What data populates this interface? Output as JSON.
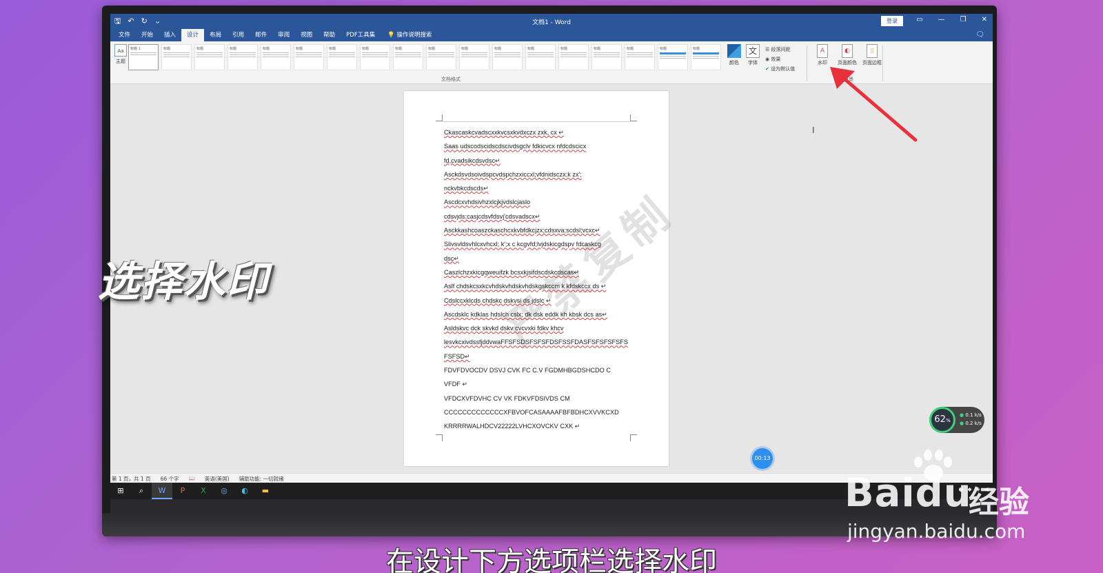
{
  "window": {
    "title": "文档1 - Word",
    "login_label": "登录",
    "controls": [
      "▭",
      "—",
      "❐",
      "✕"
    ]
  },
  "menu": {
    "tabs": [
      "文件",
      "开始",
      "插入",
      "设计",
      "布局",
      "引用",
      "邮件",
      "审阅",
      "视图",
      "帮助",
      "PDF工具集"
    ],
    "active_tab": "设计",
    "tell_me": "操作说明搜索"
  },
  "ribbon": {
    "theme_label": "主题",
    "document_format_label": "文档格式",
    "style_thumbs": [
      "标题 1",
      "标题",
      "标题",
      "标题",
      "标题",
      "标题",
      "标题",
      "标题",
      "标题",
      "标题",
      "标题",
      "标题",
      "标题",
      "标题",
      "标题",
      "标题",
      "标题",
      "标题"
    ],
    "colors_label": "颜色",
    "fonts_label": "字体",
    "paragraph_spacing_label": "段落间距",
    "effects_label": "效果",
    "set_default_label": "设为默认值",
    "watermark_label": "水印",
    "page_color_label": "页面颜色",
    "page_border_label": "页面边框",
    "page_background_label": "页面背景"
  },
  "document": {
    "watermark_text": "严禁复制",
    "lines": [
      "Ckascaskcvadscxxkvcsxkvdxczx zxk, cx ↵",
      "Saas   udscodscidscdscivdsgclv    fdkicvcx    nfdcdscicx",
      "fd,cvadsikcdsvdsc↵",
      "Asckdsvdsoivdspcvdspchzxiccxl;vfdnidsczx;k              zx';",
      "nckvbkcdscds↵",
      "Ascdcxvhdsivhzxlcjkjvdslcjaslo",
      "cdsvjds;casjcdsvfdsvj'cdsvadscx↵",
      "Asckkashcoaszckaschcxkvbfdkcjzx;cdsxva;scdsl;vcxc↵",
      "Slivsvldsvhlcxvhcxl;  k';x   c   kcgvfd;lvjdskicgdspv   fdcaskcg",
      "dsc↵",
      "Caszlchzxkicgqweuifzk bcsxkjsifdscdskcdscas↵",
      "Aslf  chdskcsxkcvhdskvhdskvhdskgskccm k kfdskccx  ds  ↵",
      "Cdslccxklcds    chdskc  dskvsi     ds  jdslc  ↵",
      "Ascdsklc kdklas hdslch cslx; dk dsk eddk kh kbsk dcs as↵",
      "Asldskvc    dck    skvkd    dskv      cvcvxki     fdkv    khcv",
      "lesvkcxivdssfjddvwaFFSFSDSFSFSFDSFSSFDASFSFSFSFSFS",
      "FSFSD↵",
      "FDVFDVOCDV DSVJ CVK FC C.V FGDMHBGDSHCDO C",
      "VFDF ↵",
      "VFDCXVFDVHC     CV     VK     FDKVFDSIVDS           CM",
      "CCCCCCCCCCCCCXFBVOFCASAAAAFBFBDHCXVVKCXD",
      "KRRRRWALHDCV22222LVHCXOVCKV CXK         ↵"
    ]
  },
  "status": {
    "page": "第 1 页，共 1 页",
    "words": "66 个字",
    "language": "英语(美国)",
    "accessibility": "辅助功能: 一切就绪"
  },
  "overlay": {
    "timer": "00:13",
    "cpu_percent": "62",
    "cpu_unit": "%",
    "upload_rate": "0.1",
    "download_rate": "0.2",
    "rate_unit": "k/s",
    "big_caption": "选择水印",
    "subtitle": "在设计下方选项栏选择水印",
    "brand_logo": "Baidu",
    "brand_cn": "经验",
    "brand_url": "jingyan.baidu.com"
  },
  "colors": {
    "word_blue": "#2b579a",
    "arrow_red": "#e8313a",
    "timer_blue": "#2e8ff0"
  }
}
